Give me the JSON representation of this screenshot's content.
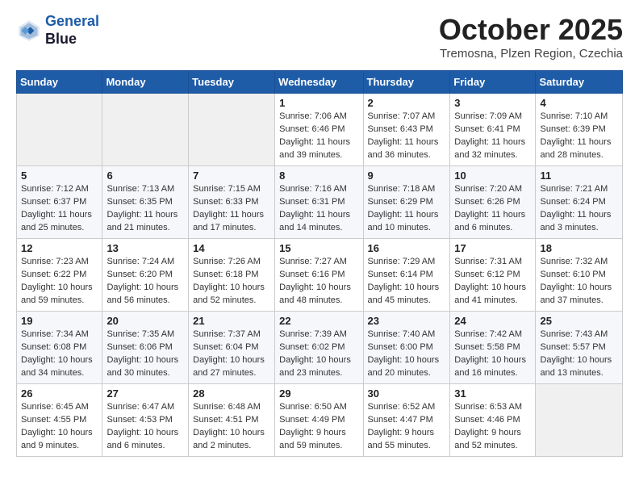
{
  "header": {
    "logo_line1": "General",
    "logo_line2": "Blue",
    "month": "October 2025",
    "location": "Tremosna, Plzen Region, Czechia"
  },
  "weekdays": [
    "Sunday",
    "Monday",
    "Tuesday",
    "Wednesday",
    "Thursday",
    "Friday",
    "Saturday"
  ],
  "weeks": [
    [
      {
        "day": "",
        "info": ""
      },
      {
        "day": "",
        "info": ""
      },
      {
        "day": "",
        "info": ""
      },
      {
        "day": "1",
        "info": "Sunrise: 7:06 AM\nSunset: 6:46 PM\nDaylight: 11 hours\nand 39 minutes."
      },
      {
        "day": "2",
        "info": "Sunrise: 7:07 AM\nSunset: 6:43 PM\nDaylight: 11 hours\nand 36 minutes."
      },
      {
        "day": "3",
        "info": "Sunrise: 7:09 AM\nSunset: 6:41 PM\nDaylight: 11 hours\nand 32 minutes."
      },
      {
        "day": "4",
        "info": "Sunrise: 7:10 AM\nSunset: 6:39 PM\nDaylight: 11 hours\nand 28 minutes."
      }
    ],
    [
      {
        "day": "5",
        "info": "Sunrise: 7:12 AM\nSunset: 6:37 PM\nDaylight: 11 hours\nand 25 minutes."
      },
      {
        "day": "6",
        "info": "Sunrise: 7:13 AM\nSunset: 6:35 PM\nDaylight: 11 hours\nand 21 minutes."
      },
      {
        "day": "7",
        "info": "Sunrise: 7:15 AM\nSunset: 6:33 PM\nDaylight: 11 hours\nand 17 minutes."
      },
      {
        "day": "8",
        "info": "Sunrise: 7:16 AM\nSunset: 6:31 PM\nDaylight: 11 hours\nand 14 minutes."
      },
      {
        "day": "9",
        "info": "Sunrise: 7:18 AM\nSunset: 6:29 PM\nDaylight: 11 hours\nand 10 minutes."
      },
      {
        "day": "10",
        "info": "Sunrise: 7:20 AM\nSunset: 6:26 PM\nDaylight: 11 hours\nand 6 minutes."
      },
      {
        "day": "11",
        "info": "Sunrise: 7:21 AM\nSunset: 6:24 PM\nDaylight: 11 hours\nand 3 minutes."
      }
    ],
    [
      {
        "day": "12",
        "info": "Sunrise: 7:23 AM\nSunset: 6:22 PM\nDaylight: 10 hours\nand 59 minutes."
      },
      {
        "day": "13",
        "info": "Sunrise: 7:24 AM\nSunset: 6:20 PM\nDaylight: 10 hours\nand 56 minutes."
      },
      {
        "day": "14",
        "info": "Sunrise: 7:26 AM\nSunset: 6:18 PM\nDaylight: 10 hours\nand 52 minutes."
      },
      {
        "day": "15",
        "info": "Sunrise: 7:27 AM\nSunset: 6:16 PM\nDaylight: 10 hours\nand 48 minutes."
      },
      {
        "day": "16",
        "info": "Sunrise: 7:29 AM\nSunset: 6:14 PM\nDaylight: 10 hours\nand 45 minutes."
      },
      {
        "day": "17",
        "info": "Sunrise: 7:31 AM\nSunset: 6:12 PM\nDaylight: 10 hours\nand 41 minutes."
      },
      {
        "day": "18",
        "info": "Sunrise: 7:32 AM\nSunset: 6:10 PM\nDaylight: 10 hours\nand 37 minutes."
      }
    ],
    [
      {
        "day": "19",
        "info": "Sunrise: 7:34 AM\nSunset: 6:08 PM\nDaylight: 10 hours\nand 34 minutes."
      },
      {
        "day": "20",
        "info": "Sunrise: 7:35 AM\nSunset: 6:06 PM\nDaylight: 10 hours\nand 30 minutes."
      },
      {
        "day": "21",
        "info": "Sunrise: 7:37 AM\nSunset: 6:04 PM\nDaylight: 10 hours\nand 27 minutes."
      },
      {
        "day": "22",
        "info": "Sunrise: 7:39 AM\nSunset: 6:02 PM\nDaylight: 10 hours\nand 23 minutes."
      },
      {
        "day": "23",
        "info": "Sunrise: 7:40 AM\nSunset: 6:00 PM\nDaylight: 10 hours\nand 20 minutes."
      },
      {
        "day": "24",
        "info": "Sunrise: 7:42 AM\nSunset: 5:58 PM\nDaylight: 10 hours\nand 16 minutes."
      },
      {
        "day": "25",
        "info": "Sunrise: 7:43 AM\nSunset: 5:57 PM\nDaylight: 10 hours\nand 13 minutes."
      }
    ],
    [
      {
        "day": "26",
        "info": "Sunrise: 6:45 AM\nSunset: 4:55 PM\nDaylight: 10 hours\nand 9 minutes."
      },
      {
        "day": "27",
        "info": "Sunrise: 6:47 AM\nSunset: 4:53 PM\nDaylight: 10 hours\nand 6 minutes."
      },
      {
        "day": "28",
        "info": "Sunrise: 6:48 AM\nSunset: 4:51 PM\nDaylight: 10 hours\nand 2 minutes."
      },
      {
        "day": "29",
        "info": "Sunrise: 6:50 AM\nSunset: 4:49 PM\nDaylight: 9 hours\nand 59 minutes."
      },
      {
        "day": "30",
        "info": "Sunrise: 6:52 AM\nSunset: 4:47 PM\nDaylight: 9 hours\nand 55 minutes."
      },
      {
        "day": "31",
        "info": "Sunrise: 6:53 AM\nSunset: 4:46 PM\nDaylight: 9 hours\nand 52 minutes."
      },
      {
        "day": "",
        "info": ""
      }
    ]
  ]
}
